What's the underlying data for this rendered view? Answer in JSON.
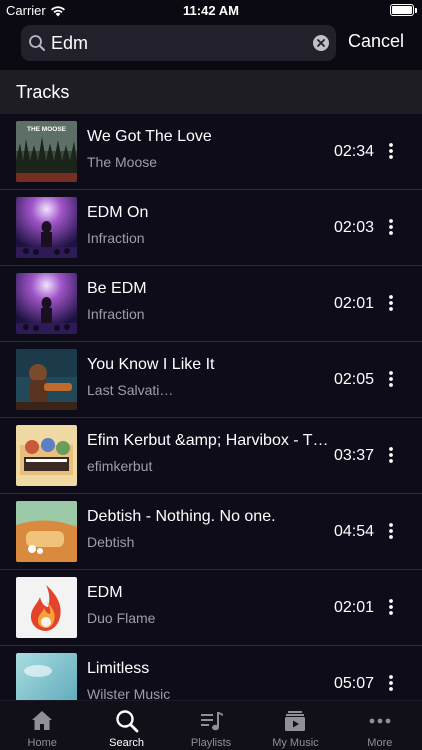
{
  "status_bar": {
    "carrier": "Carrier",
    "time": "11:42 AM"
  },
  "search": {
    "value": "Edm",
    "cancel_label": "Cancel"
  },
  "section": {
    "title": "Tracks"
  },
  "tracks": [
    {
      "title": "We Got The Love",
      "artist": "The Moose",
      "duration": "02:34",
      "art_text": "THE MOOSE"
    },
    {
      "title": "EDM On",
      "artist": "Infraction",
      "duration": "02:03"
    },
    {
      "title": "Be EDM",
      "artist": "Infraction",
      "duration": "02:01"
    },
    {
      "title": "You Know I Like It",
      "artist": "Last Salvati…",
      "duration": "02:05"
    },
    {
      "title": "Efim Kerbut &amp; Harvibox - T…",
      "artist": "efimkerbut",
      "duration": "03:37"
    },
    {
      "title": "Debtish - Nothing. No one.",
      "artist": "Debtish",
      "duration": "04:54"
    },
    {
      "title": "EDM",
      "artist": "Duo Flame",
      "duration": "02:01"
    },
    {
      "title": "Limitless",
      "artist": "Wilster Music",
      "duration": "05:07"
    }
  ],
  "tab_bar": {
    "tabs": [
      {
        "label": "Home",
        "icon": "home-icon"
      },
      {
        "label": "Search",
        "icon": "search-icon",
        "active": true
      },
      {
        "label": "Playlists",
        "icon": "playlists-icon"
      },
      {
        "label": "My Music",
        "icon": "my-music-icon"
      },
      {
        "label": "More",
        "icon": "more-icon"
      }
    ]
  },
  "colors": {
    "background": "#0d0c18",
    "section_header": "#1d1d23",
    "secondary_text": "#9e9daa",
    "tab_inactive": "#8f8e99"
  }
}
